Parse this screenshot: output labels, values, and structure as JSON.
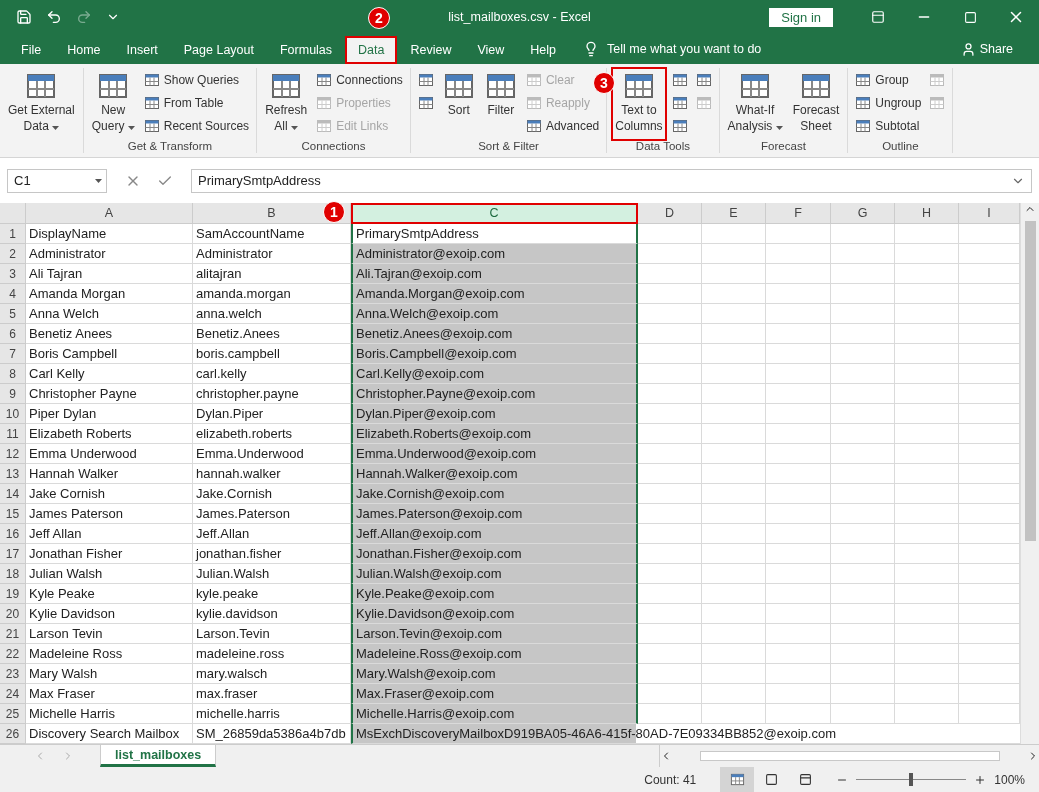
{
  "window": {
    "title": "list_mailboxes.csv  -  Excel",
    "sign_in": "Sign in"
  },
  "tabs": [
    {
      "label": "File",
      "selected": false,
      "highlighted": false
    },
    {
      "label": "Home",
      "selected": false,
      "highlighted": false
    },
    {
      "label": "Insert",
      "selected": false,
      "highlighted": false
    },
    {
      "label": "Page Layout",
      "selected": false,
      "highlighted": false
    },
    {
      "label": "Formulas",
      "selected": false,
      "highlighted": false
    },
    {
      "label": "Data",
      "selected": true,
      "highlighted": true
    },
    {
      "label": "Review",
      "selected": false,
      "highlighted": false
    },
    {
      "label": "View",
      "selected": false,
      "highlighted": false
    },
    {
      "label": "Help",
      "selected": false,
      "highlighted": false
    }
  ],
  "tell_me": "Tell me what you want to do",
  "share": "Share",
  "ribbon": [
    {
      "columns": [
        {
          "kind": "large",
          "lines": [
            "Get External",
            "Data"
          ],
          "dropdown": true,
          "disabled": false,
          "highlighted": false
        }
      ]
    },
    {
      "label": "Get & Transform",
      "columns": [
        {
          "kind": "large",
          "lines": [
            "New",
            "Query"
          ],
          "dropdown": true,
          "disabled": false,
          "highlighted": false
        },
        {
          "kind": "stack",
          "items": [
            {
              "label": "Show Queries",
              "disabled": false
            },
            {
              "label": "From Table",
              "disabled": false
            },
            {
              "label": "Recent Sources",
              "disabled": false
            }
          ]
        }
      ]
    },
    {
      "label": "Connections",
      "columns": [
        {
          "kind": "large",
          "lines": [
            "Refresh",
            "All"
          ],
          "dropdown": true,
          "disabled": false,
          "highlighted": false
        },
        {
          "kind": "stack",
          "items": [
            {
              "label": "Connections",
              "disabled": false
            },
            {
              "label": "Properties",
              "disabled": true
            },
            {
              "label": "Edit Links",
              "disabled": true
            }
          ]
        }
      ]
    },
    {
      "label": "Sort & Filter",
      "columns": [
        {
          "kind": "stack",
          "items": [
            {
              "disabled": false
            },
            {
              "disabled": false
            }
          ]
        },
        {
          "kind": "large",
          "lines": [
            "Sort"
          ],
          "dropdown": false,
          "disabled": false,
          "highlighted": false
        },
        {
          "kind": "large",
          "lines": [
            "Filter"
          ],
          "dropdown": false,
          "disabled": false,
          "highlighted": false
        },
        {
          "kind": "stack",
          "items": [
            {
              "label": "Clear",
              "disabled": true
            },
            {
              "label": "Reapply",
              "disabled": true
            },
            {
              "label": "Advanced",
              "disabled": false
            }
          ]
        }
      ]
    },
    {
      "label": "Data Tools",
      "columns": [
        {
          "kind": "large",
          "lines": [
            "Text to",
            "Columns"
          ],
          "dropdown": false,
          "disabled": false,
          "highlighted": true
        },
        {
          "kind": "stack",
          "items": [
            {
              "disabled": false
            },
            {
              "disabled": false
            },
            {
              "disabled": false
            }
          ]
        },
        {
          "kind": "stack",
          "items": [
            {
              "disabled": false
            },
            {
              "disabled": true
            }
          ]
        }
      ]
    },
    {
      "label": "Forecast",
      "columns": [
        {
          "kind": "large",
          "lines": [
            "What-If",
            "Analysis"
          ],
          "dropdown": true,
          "disabled": false,
          "highlighted": false
        },
        {
          "kind": "large",
          "lines": [
            "Forecast",
            "Sheet"
          ],
          "dropdown": false,
          "disabled": false,
          "highlighted": false
        }
      ]
    },
    {
      "label": "Outline",
      "columns": [
        {
          "kind": "stack",
          "items": [
            {
              "label": "Group",
              "disabled": false
            },
            {
              "label": "Ungroup",
              "disabled": false
            },
            {
              "label": "Subtotal",
              "disabled": false
            }
          ]
        },
        {
          "kind": "stack",
          "items": [
            {
              "disabled": true
            },
            {
              "disabled": true
            }
          ]
        }
      ]
    }
  ],
  "formula_bar": {
    "name_box": "C1",
    "value": "PrimarySmtpAddress"
  },
  "columns": [
    {
      "label": "A",
      "selected": false,
      "highlighted": false
    },
    {
      "label": "B",
      "selected": false,
      "highlighted": false
    },
    {
      "label": "C",
      "selected": true,
      "highlighted": true
    },
    {
      "label": "D",
      "selected": false,
      "highlighted": false
    },
    {
      "label": "E",
      "selected": false,
      "highlighted": false
    },
    {
      "label": "F",
      "selected": false,
      "highlighted": false
    },
    {
      "label": "G",
      "selected": false,
      "highlighted": false
    },
    {
      "label": "H",
      "selected": false,
      "highlighted": false
    },
    {
      "label": "I",
      "selected": false,
      "highlighted": false
    }
  ],
  "rows": [
    {
      "number": "1",
      "cells": [
        "DisplayName",
        "SamAccountName",
        "PrimarySmtpAddress"
      ],
      "selected": false
    },
    {
      "number": "2",
      "cells": [
        "Administrator",
        "Administrator",
        "Administrator@exoip.com"
      ],
      "selected": true
    },
    {
      "number": "3",
      "cells": [
        "Ali Tajran",
        "alitajran",
        "Ali.Tajran@exoip.com"
      ],
      "selected": true
    },
    {
      "number": "4",
      "cells": [
        "Amanda Morgan",
        "amanda.morgan",
        "Amanda.Morgan@exoip.com"
      ],
      "selected": true
    },
    {
      "number": "5",
      "cells": [
        "Anna Welch",
        "anna.welch",
        "Anna.Welch@exoip.com"
      ],
      "selected": true
    },
    {
      "number": "6",
      "cells": [
        "Benetiz Anees",
        "Benetiz.Anees",
        "Benetiz.Anees@exoip.com"
      ],
      "selected": true
    },
    {
      "number": "7",
      "cells": [
        "Boris Campbell",
        "boris.campbell",
        "Boris.Campbell@exoip.com"
      ],
      "selected": true
    },
    {
      "number": "8",
      "cells": [
        "Carl Kelly",
        "carl.kelly",
        "Carl.Kelly@exoip.com"
      ],
      "selected": true
    },
    {
      "number": "9",
      "cells": [
        "Christopher Payne",
        "christopher.payne",
        "Christopher.Payne@exoip.com"
      ],
      "selected": true
    },
    {
      "number": "10",
      "cells": [
        "Piper Dylan",
        "Dylan.Piper",
        "Dylan.Piper@exoip.com"
      ],
      "selected": true
    },
    {
      "number": "11",
      "cells": [
        "Elizabeth Roberts",
        "elizabeth.roberts",
        "Elizabeth.Roberts@exoip.com"
      ],
      "selected": true
    },
    {
      "number": "12",
      "cells": [
        "Emma Underwood",
        "Emma.Underwood",
        "Emma.Underwood@exoip.com"
      ],
      "selected": true
    },
    {
      "number": "13",
      "cells": [
        "Hannah Walker",
        "hannah.walker",
        "Hannah.Walker@exoip.com"
      ],
      "selected": true
    },
    {
      "number": "14",
      "cells": [
        "Jake Cornish",
        "Jake.Cornish",
        "Jake.Cornish@exoip.com"
      ],
      "selected": true
    },
    {
      "number": "15",
      "cells": [
        "James Paterson",
        "James.Paterson",
        "James.Paterson@exoip.com"
      ],
      "selected": true
    },
    {
      "number": "16",
      "cells": [
        "Jeff Allan",
        "Jeff.Allan",
        "Jeff.Allan@exoip.com"
      ],
      "selected": true
    },
    {
      "number": "17",
      "cells": [
        "Jonathan Fisher",
        "jonathan.fisher",
        "Jonathan.Fisher@exoip.com"
      ],
      "selected": true
    },
    {
      "number": "18",
      "cells": [
        "Julian Walsh",
        "Julian.Walsh",
        "Julian.Walsh@exoip.com"
      ],
      "selected": true
    },
    {
      "number": "19",
      "cells": [
        "Kyle Peake",
        "kyle.peake",
        "Kyle.Peake@exoip.com"
      ],
      "selected": true
    },
    {
      "number": "20",
      "cells": [
        "Kylie Davidson",
        "kylie.davidson",
        "Kylie.Davidson@exoip.com"
      ],
      "selected": true
    },
    {
      "number": "21",
      "cells": [
        "Larson Tevin",
        "Larson.Tevin",
        "Larson.Tevin@exoip.com"
      ],
      "selected": true
    },
    {
      "number": "22",
      "cells": [
        "Madeleine Ross",
        "madeleine.ross",
        "Madeleine.Ross@exoip.com"
      ],
      "selected": true
    },
    {
      "number": "23",
      "cells": [
        "Mary Walsh",
        "mary.walsch",
        "Mary.Walsh@exoip.com"
      ],
      "selected": true
    },
    {
      "number": "24",
      "cells": [
        "Max Fraser",
        "max.fraser",
        "Max.Fraser@exoip.com"
      ],
      "selected": true
    },
    {
      "number": "25",
      "cells": [
        "Michelle Harris",
        "michelle.harris",
        "Michelle.Harris@exoip.com"
      ],
      "selected": true
    },
    {
      "number": "26",
      "cells": [
        "Discovery Search Mailbox",
        "SM_26859da5386a4b7db",
        "MsExchDiscoveryMailboxD919BA05-46A6-415f-80AD-7E09334BB852@exoip.com"
      ],
      "selected": true
    }
  ],
  "sheet_tabs": [
    {
      "label": "list_mailboxes",
      "selected": true
    }
  ],
  "status_bar": {
    "count": "Count: 41",
    "zoom": {
      "level": 0.5,
      "reading": "100%"
    }
  },
  "callouts": [
    {
      "text": "1"
    },
    {
      "text": "2"
    },
    {
      "text": "3"
    }
  ]
}
